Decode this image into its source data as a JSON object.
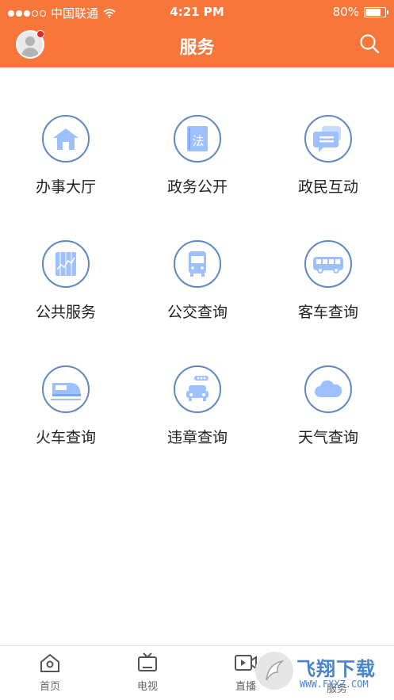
{
  "status_bar": {
    "carrier": "中国联通",
    "time": "4:21 PM",
    "battery": "80%",
    "battery_level": 0.8
  },
  "header": {
    "title": "服务",
    "avatar_icon": "user-avatar-icon",
    "notification_dot_color": "#e8251f",
    "search_icon": "search-icon"
  },
  "colors": {
    "accent": "#f7763a",
    "icon_blue": "#5f87c1",
    "icon_fill": "#9ec0ff"
  },
  "services": [
    {
      "label": "办事大厅",
      "icon": "house-icon"
    },
    {
      "label": "政务公开",
      "icon": "law-book-icon",
      "icon_text": "法"
    },
    {
      "label": "政民互动",
      "icon": "chat-bubbles-icon"
    },
    {
      "label": "公共服务",
      "icon": "chart-panel-icon"
    },
    {
      "label": "公交查询",
      "icon": "bus-front-icon"
    },
    {
      "label": "客车查询",
      "icon": "coach-bus-icon"
    },
    {
      "label": "火车查询",
      "icon": "train-icon"
    },
    {
      "label": "违章查询",
      "icon": "traffic-car-icon"
    },
    {
      "label": "天气查询",
      "icon": "cloud-icon"
    }
  ],
  "tabbar": {
    "tabs": [
      {
        "label": "首页",
        "icon": "home-icon"
      },
      {
        "label": "电视",
        "icon": "tv-icon"
      },
      {
        "label": "直播",
        "icon": "video-camera-icon"
      },
      {
        "label": "服务",
        "icon": "service-icon"
      }
    ]
  },
  "watermark": {
    "brand": "飞翔下载",
    "url": "WWW.FXXZ.COM"
  }
}
